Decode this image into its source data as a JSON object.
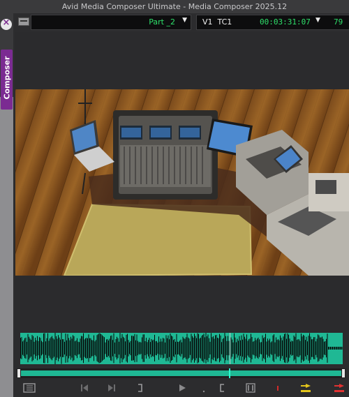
{
  "window": {
    "title": "Avid Media Composer Ultimate - Media Composer 2025.12"
  },
  "sidebar": {
    "close_glyph": "×",
    "tab_label": "Composer"
  },
  "header": {
    "clip_name": "Part _2",
    "track": "V1",
    "tc_label": "TC1",
    "timecode": "00:03:31:07",
    "extra_timecode": "79"
  },
  "colors": {
    "timecode_green": "#2ee06a",
    "waveform_fill": "#1fb894",
    "tab_purple": "#7b2b92"
  },
  "icons": {
    "menu": "fast-menu-icon",
    "clip_dropdown": "dropdown-arrow-icon",
    "tc_dropdown": "dropdown-arrow-icon",
    "toolbar": [
      "track-list-icon",
      "step-backward-icon",
      "step-forward-icon",
      "mark-out-icon",
      "play-icon",
      "dot-icon",
      "mark-in-icon",
      "mark-clip-icon",
      "red-marker-icon",
      "splice-in-icon",
      "overwrite-icon"
    ]
  },
  "playback": {
    "position": 0.65
  }
}
